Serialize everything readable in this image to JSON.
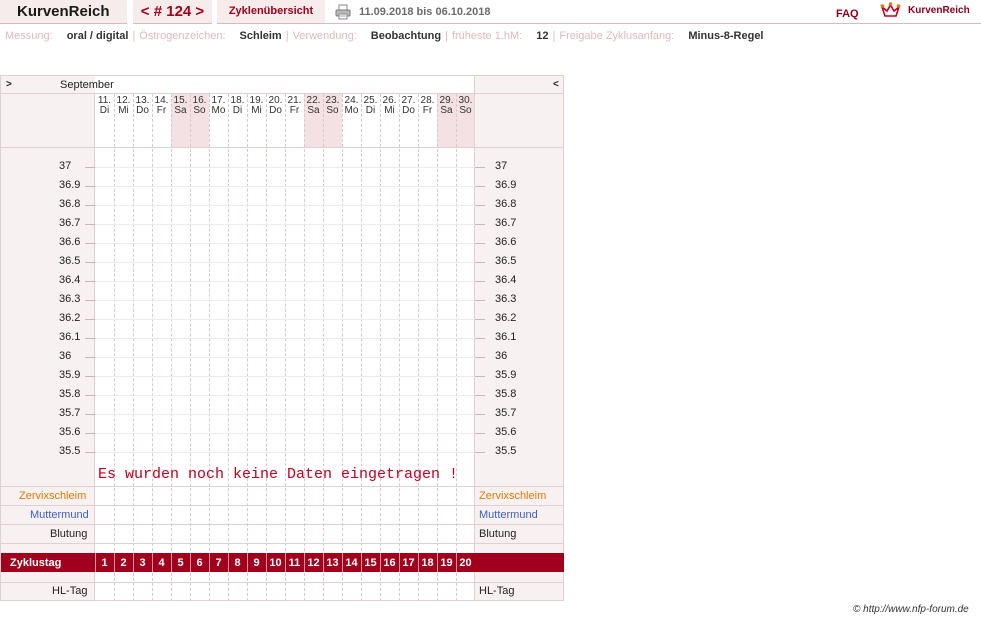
{
  "header": {
    "app_title": "KurvenReich",
    "cycle_nav": "< # 124 >",
    "overview_label": "Zyklenübersicht",
    "date_range": "11.09.2018 bis 06.10.2018",
    "faq_label": "FAQ",
    "logo_text": "KurvenReich"
  },
  "info": [
    {
      "label": "Messung:",
      "value": "oral / digital"
    },
    {
      "label": "Östrogenzeichen:",
      "value": "Schleim"
    },
    {
      "label": "Verwendung:",
      "value": "Beobachtung"
    },
    {
      "label": "früheste 1.hM:",
      "value": "12"
    },
    {
      "label": "Freigabe Zyklusanfang:",
      "value": "Minus-8-Regel"
    }
  ],
  "chart": {
    "nav_prev": ">",
    "nav_next": "<",
    "month": "September",
    "days": [
      {
        "date": "11.",
        "wd": "Di",
        "weekend": false
      },
      {
        "date": "12.",
        "wd": "Mi",
        "weekend": false
      },
      {
        "date": "13.",
        "wd": "Do",
        "weekend": false
      },
      {
        "date": "14.",
        "wd": "Fr",
        "weekend": false
      },
      {
        "date": "15.",
        "wd": "Sa",
        "weekend": true
      },
      {
        "date": "16.",
        "wd": "So",
        "weekend": true
      },
      {
        "date": "17.",
        "wd": "Mo",
        "weekend": false
      },
      {
        "date": "18.",
        "wd": "Di",
        "weekend": false
      },
      {
        "date": "19.",
        "wd": "Mi",
        "weekend": false
      },
      {
        "date": "20.",
        "wd": "Do",
        "weekend": false
      },
      {
        "date": "21.",
        "wd": "Fr",
        "weekend": false
      },
      {
        "date": "22.",
        "wd": "Sa",
        "weekend": true
      },
      {
        "date": "23.",
        "wd": "So",
        "weekend": true
      },
      {
        "date": "24.",
        "wd": "Mo",
        "weekend": false
      },
      {
        "date": "25.",
        "wd": "Di",
        "weekend": false
      },
      {
        "date": "26.",
        "wd": "Mi",
        "weekend": false
      },
      {
        "date": "27.",
        "wd": "Do",
        "weekend": false
      },
      {
        "date": "28.",
        "wd": "Fr",
        "weekend": false
      },
      {
        "date": "29.",
        "wd": "Sa",
        "weekend": true
      },
      {
        "date": "30.",
        "wd": "So",
        "weekend": true
      }
    ],
    "temperatures": [
      "37",
      "36.9",
      "36.8",
      "36.7",
      "36.6",
      "36.5",
      "36.4",
      "36.3",
      "36.2",
      "36.1",
      "36",
      "35.9",
      "35.8",
      "35.7",
      "35.6",
      "35.5"
    ],
    "no_data_message": "Es wurden noch keine Daten eingetragen !",
    "rows": {
      "zervix": "Zervixschleim",
      "muttermund": "Muttermund",
      "blutung": "Blutung",
      "zyklustag": "Zyklustag",
      "hltag": "HL-Tag"
    },
    "cycle_days": [
      "1",
      "2",
      "3",
      "4",
      "5",
      "6",
      "7",
      "8",
      "9",
      "10",
      "11",
      "12",
      "13",
      "14",
      "15",
      "16",
      "17",
      "18",
      "19",
      "20"
    ]
  },
  "colors": {
    "accent": "#a0001c",
    "zervix": "#e07c00",
    "muttermund": "#3f5fbf"
  },
  "footer": {
    "copyright": "© http://www.nfp-forum.de"
  }
}
